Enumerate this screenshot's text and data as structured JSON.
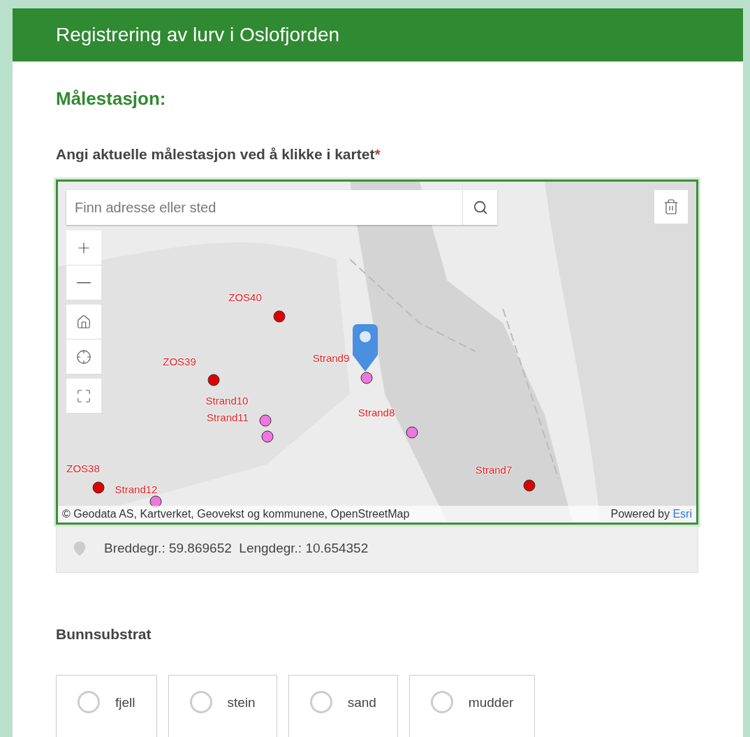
{
  "header": {
    "title": "Registrering av lurv i Oslofjorden"
  },
  "section_title": "Målestasjon:",
  "question": {
    "label": "Angi aktuelle målestasjon ved å klikke i kartet",
    "required_mark": "*"
  },
  "map": {
    "search": {
      "placeholder": "Finn adresse eller sted"
    },
    "stations": [
      {
        "label": "ZOS40",
        "color": "#dd0000"
      },
      {
        "label": "ZOS39",
        "color": "#dd0000"
      },
      {
        "label": "Strand9",
        "color": "#ee77dd"
      },
      {
        "label": "Strand10",
        "color": "#ee77dd"
      },
      {
        "label": "Strand11",
        "color": "#ee77dd"
      },
      {
        "label": "Strand8",
        "color": "#ee77dd"
      },
      {
        "label": "ZOS38",
        "color": "#dd0000"
      },
      {
        "label": "Strand7",
        "color": "#dd0000"
      },
      {
        "label": "Strand12",
        "color": "#ee77dd"
      }
    ],
    "attribution": "© Geodata AS, Kartverket, Geovekst og kommunene, OpenStreetMap",
    "powered_by": "Powered by",
    "powered_link": "Esri"
  },
  "coordinates": "Breddegr.: 59.869652  Lengdegr.: 10.654352",
  "substrate": {
    "label": "Bunnsubstrat",
    "options": [
      {
        "label": "fjell",
        "selected": false
      },
      {
        "label": "stein",
        "selected": false
      },
      {
        "label": "sand",
        "selected": false
      },
      {
        "label": "mudder",
        "selected": false
      }
    ]
  }
}
